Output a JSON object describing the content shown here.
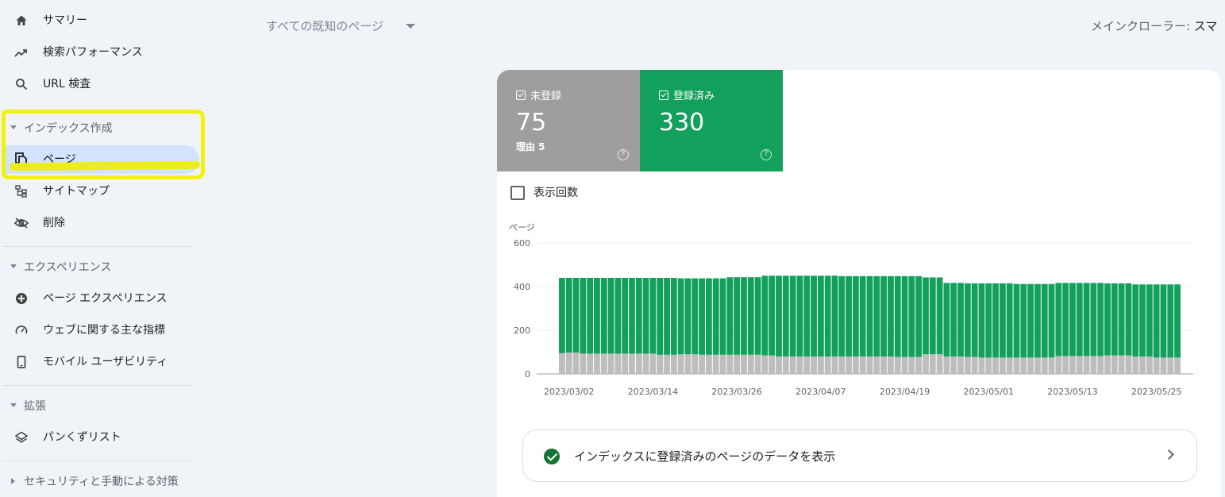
{
  "sidebar": {
    "items_top": [
      {
        "label": "サマリー",
        "icon": "home-icon"
      },
      {
        "label": "検索パフォーマンス",
        "icon": "trending-up-icon"
      },
      {
        "label": "URL 検査",
        "icon": "search-icon"
      }
    ],
    "sections": [
      {
        "label": "インデックス作成",
        "items": [
          {
            "label": "ページ",
            "icon": "pages-icon",
            "active": true
          },
          {
            "label": "サイトマップ",
            "icon": "sitemap-icon"
          },
          {
            "label": "削除",
            "icon": "visibility-off-icon"
          }
        ]
      },
      {
        "label": "エクスペリエンス",
        "items": [
          {
            "label": "ページ エクスペリエンス",
            "icon": "add-circle-icon"
          },
          {
            "label": "ウェブに関する主な指標",
            "icon": "speed-gauge-icon"
          },
          {
            "label": "モバイル ユーザビリティ",
            "icon": "smartphone-icon"
          }
        ]
      },
      {
        "label": "拡張",
        "items": [
          {
            "label": "パンくずリスト",
            "icon": "layers-icon"
          }
        ]
      },
      {
        "label": "セキュリティと手動による対策",
        "items": []
      }
    ],
    "highlight_color": "#f1f10a"
  },
  "topbar": {
    "filter_label": "すべての既知のページ",
    "crawler_prefix": "メインクローラー: ",
    "crawler_value": "スマ"
  },
  "tiles": [
    {
      "label": "未登録",
      "value": "75",
      "sub": "理由 5",
      "color": "#9e9e9e"
    },
    {
      "label": "登録済み",
      "value": "330",
      "sub": "",
      "color": "#12a05c"
    }
  ],
  "impressions_label": "表示回数",
  "cta_label": "インデックスに登録済みのページのデータを表示",
  "chart_data": {
    "type": "bar",
    "stacked": true,
    "ylabel": "ページ",
    "ylim": [
      0,
      600
    ],
    "yticks": [
      0,
      200,
      400,
      600
    ],
    "xtick_labels": [
      "2023/03/02",
      "2023/03/14",
      "2023/03/26",
      "2023/04/07",
      "2023/04/19",
      "2023/05/01",
      "2023/05/13",
      "2023/05/25"
    ],
    "categories": [
      "2023/03/01",
      "2023/03/02",
      "2023/03/03",
      "2023/03/04",
      "2023/03/05",
      "2023/03/06",
      "2023/03/07",
      "2023/03/08",
      "2023/03/09",
      "2023/03/10",
      "2023/03/11",
      "2023/03/12",
      "2023/03/13",
      "2023/03/14",
      "2023/03/15",
      "2023/03/16",
      "2023/03/17",
      "2023/03/18",
      "2023/03/19",
      "2023/03/20",
      "2023/03/21",
      "2023/03/22",
      "2023/03/23",
      "2023/03/24",
      "2023/03/25",
      "2023/03/26",
      "2023/03/27",
      "2023/03/28",
      "2023/03/29",
      "2023/03/30",
      "2023/03/31",
      "2023/04/01",
      "2023/04/02",
      "2023/04/03",
      "2023/04/04",
      "2023/04/05",
      "2023/04/06",
      "2023/04/07",
      "2023/04/08",
      "2023/04/09",
      "2023/04/10",
      "2023/04/11",
      "2023/04/12",
      "2023/04/13",
      "2023/04/14",
      "2023/04/15",
      "2023/04/16",
      "2023/04/17",
      "2023/04/18",
      "2023/04/19",
      "2023/04/20",
      "2023/04/21",
      "2023/04/22",
      "2023/04/23",
      "2023/04/24",
      "2023/04/25",
      "2023/04/26",
      "2023/04/27",
      "2023/04/28",
      "2023/04/29",
      "2023/04/30",
      "2023/05/01",
      "2023/05/02",
      "2023/05/03",
      "2023/05/04",
      "2023/05/05",
      "2023/05/06",
      "2023/05/07",
      "2023/05/08",
      "2023/05/09",
      "2023/05/10",
      "2023/05/11",
      "2023/05/12",
      "2023/05/13",
      "2023/05/14",
      "2023/05/15",
      "2023/05/16",
      "2023/05/17",
      "2023/05/18",
      "2023/05/19",
      "2023/05/20",
      "2023/05/21",
      "2023/05/22",
      "2023/05/23",
      "2023/05/24",
      "2023/05/25",
      "2023/05/26",
      "2023/05/27",
      "2023/05/28"
    ],
    "series": [
      {
        "name": "未登録",
        "color": "#bdbdbd",
        "values": [
          95,
          98,
          98,
          93,
          93,
          93,
          93,
          93,
          93,
          93,
          93,
          93,
          93,
          93,
          88,
          88,
          88,
          90,
          90,
          90,
          88,
          88,
          88,
          88,
          88,
          88,
          88,
          88,
          88,
          85,
          85,
          80,
          80,
          80,
          80,
          80,
          80,
          80,
          80,
          80,
          80,
          80,
          80,
          80,
          80,
          80,
          80,
          80,
          78,
          78,
          78,
          78,
          90,
          90,
          90,
          80,
          80,
          80,
          78,
          78,
          75,
          75,
          75,
          75,
          75,
          75,
          75,
          75,
          75,
          75,
          75,
          82,
          82,
          82,
          82,
          82,
          82,
          82,
          85,
          85,
          85,
          85,
          80,
          80,
          80,
          75,
          75,
          75,
          75,
          78,
          78,
          78
        ]
      },
      {
        "name": "登録済み",
        "color": "#12a05c",
        "values": [
          345,
          342,
          342,
          347,
          347,
          347,
          347,
          347,
          347,
          347,
          347,
          347,
          347,
          347,
          352,
          352,
          352,
          348,
          348,
          348,
          350,
          350,
          350,
          350,
          355,
          355,
          355,
          355,
          355,
          365,
          365,
          370,
          370,
          370,
          370,
          370,
          370,
          370,
          370,
          370,
          368,
          368,
          368,
          368,
          368,
          368,
          368,
          368,
          370,
          370,
          370,
          370,
          352,
          352,
          352,
          337,
          337,
          337,
          337,
          337,
          340,
          340,
          340,
          340,
          340,
          337,
          337,
          337,
          337,
          337,
          337,
          335,
          335,
          335,
          335,
          335,
          335,
          335,
          330,
          330,
          330,
          330,
          330,
          330,
          330,
          335,
          335,
          335,
          335,
          330,
          330,
          330
        ]
      }
    ]
  }
}
